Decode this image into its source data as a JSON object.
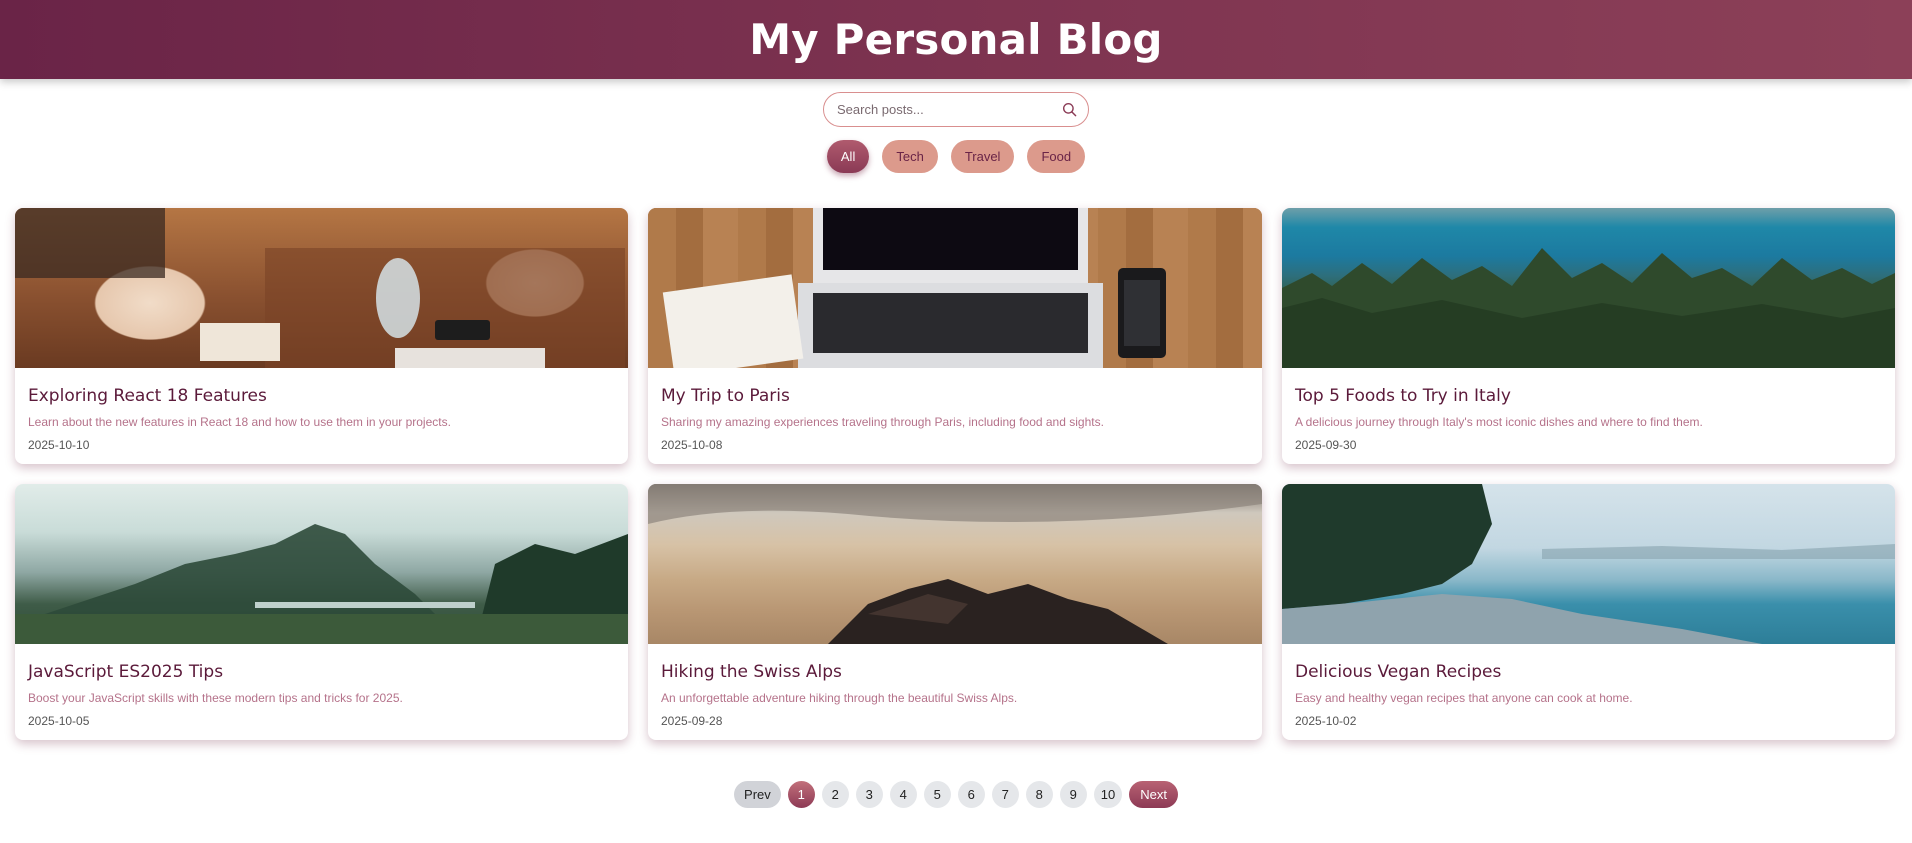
{
  "header": {
    "title": "My Personal Blog"
  },
  "search": {
    "placeholder": "Search posts..."
  },
  "filters": [
    {
      "label": "All",
      "active": true
    },
    {
      "label": "Tech",
      "active": false
    },
    {
      "label": "Travel",
      "active": false
    },
    {
      "label": "Food",
      "active": false
    }
  ],
  "posts": [
    {
      "title": "Exploring React 18 Features",
      "description": "Learn about the new features in React 18 and how to use them in your projects.",
      "date": "2025-10-10"
    },
    {
      "title": "My Trip to Paris",
      "description": "Sharing my amazing experiences traveling through Paris, including food and sights.",
      "date": "2025-10-08"
    },
    {
      "title": "Top 5 Foods to Try in Italy",
      "description": "A delicious journey through Italy's most iconic dishes and where to find them.",
      "date": "2025-09-30"
    },
    {
      "title": "JavaScript ES2025 Tips",
      "description": "Boost your JavaScript skills with these modern tips and tricks for 2025.",
      "date": "2025-10-05"
    },
    {
      "title": "Hiking the Swiss Alps",
      "description": "An unforgettable adventure hiking through the beautiful Swiss Alps.",
      "date": "2025-09-28"
    },
    {
      "title": "Delicious Vegan Recipes",
      "description": "Easy and healthy vegan recipes that anyone can cook at home.",
      "date": "2025-10-02"
    }
  ],
  "pagination": {
    "prev_label": "Prev",
    "next_label": "Next",
    "pages": [
      "1",
      "2",
      "3",
      "4",
      "5",
      "6",
      "7",
      "8",
      "9",
      "10"
    ],
    "current": "1"
  },
  "colors": {
    "brand": "#6a2447",
    "accent": "#dc9a8c",
    "title_text": "#5b1a3a",
    "description_text": "#b5728a"
  }
}
